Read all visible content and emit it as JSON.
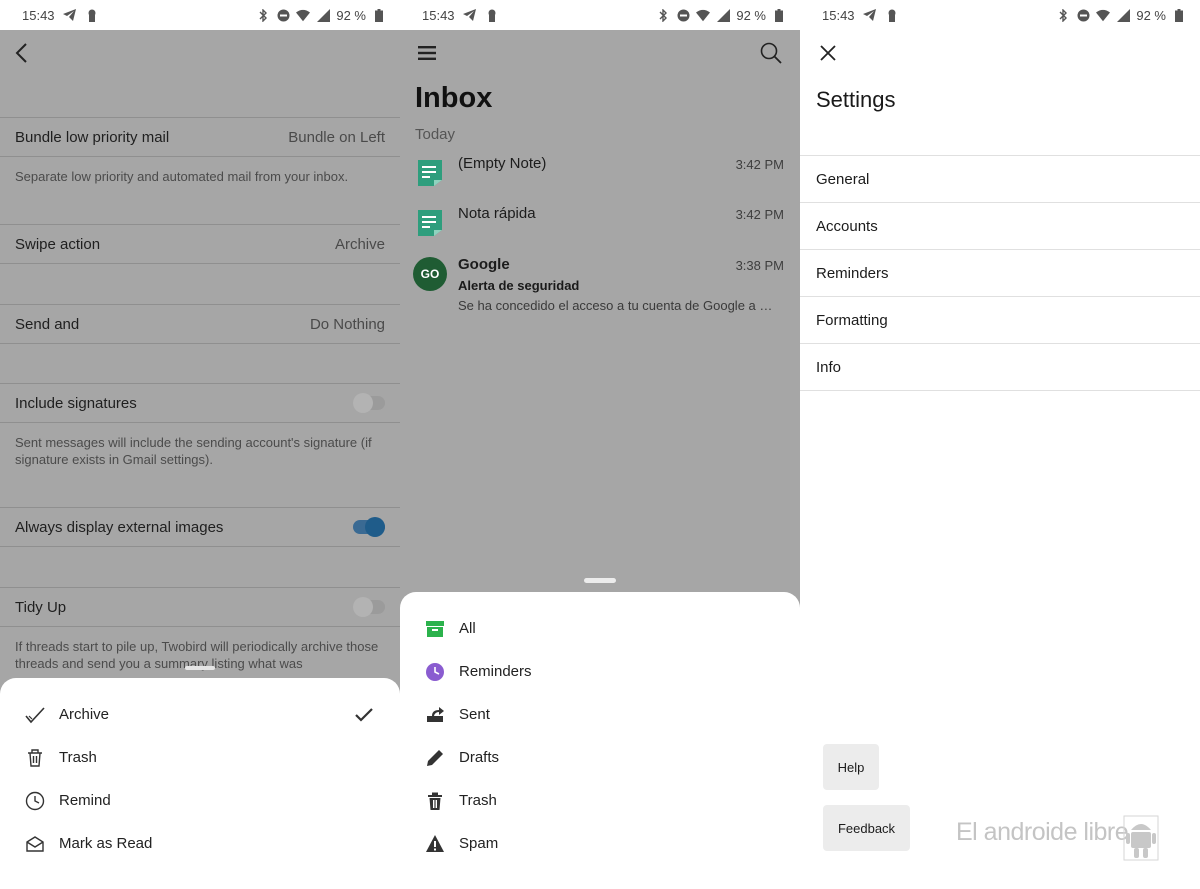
{
  "status": {
    "time": "15:43",
    "battery": "92 %"
  },
  "panel1": {
    "back_icon": "chevron-left-icon",
    "rows": [
      {
        "label": "Bundle low priority mail",
        "value": "Bundle on Left"
      },
      {
        "label": "Swipe action",
        "value": "Archive"
      },
      {
        "label": "Send and",
        "value": "Do Nothing"
      },
      {
        "label": "Include signatures",
        "toggle": "off"
      },
      {
        "label": "Always display external images",
        "toggle": "on"
      },
      {
        "label": "Tidy Up",
        "toggle": "off"
      }
    ],
    "descriptions": {
      "bundle": "Separate low priority and automated mail from your inbox.",
      "signatures": "Sent messages will include the sending account's signature (if signature exists in Gmail settings).",
      "tidy": "If threads start to pile up, Twobird will periodically archive those threads and send you a summary listing what was"
    },
    "sheet": [
      {
        "label": "Archive",
        "icon": "check-outline-icon",
        "selected": true
      },
      {
        "label": "Trash",
        "icon": "trash-icon"
      },
      {
        "label": "Remind",
        "icon": "clock-icon"
      },
      {
        "label": "Mark as Read",
        "icon": "envelope-open-icon"
      }
    ]
  },
  "panel2": {
    "title": "Inbox",
    "section": "Today",
    "mails": [
      {
        "from": "(Empty Note)",
        "time": "3:42 PM",
        "type": "note"
      },
      {
        "from": "Nota rápida",
        "time": "3:42 PM",
        "type": "note"
      },
      {
        "from": "Google",
        "time": "3:38 PM",
        "type": "contact",
        "initials": "GO",
        "subject": "Alerta de seguridad",
        "preview": "Se ha concedido el acceso a tu cuenta de Google a …"
      }
    ],
    "folders": [
      {
        "label": "All",
        "icon": "archive-box-icon",
        "color": "#2bb24c"
      },
      {
        "label": "Reminders",
        "icon": "clock-icon",
        "color": "#8a5cd0"
      },
      {
        "label": "Sent",
        "icon": "send-icon",
        "color": "#333333"
      },
      {
        "label": "Drafts",
        "icon": "pencil-icon",
        "color": "#333333"
      },
      {
        "label": "Trash",
        "icon": "trash-icon",
        "color": "#333333"
      },
      {
        "label": "Spam",
        "icon": "warning-icon",
        "color": "#333333"
      }
    ]
  },
  "panel3": {
    "title": "Settings",
    "items": [
      "General",
      "Accounts",
      "Reminders",
      "Formatting",
      "Info"
    ],
    "help_label": "Help",
    "feedback_label": "Feedback",
    "watermark": "El androide libre"
  },
  "colors": {
    "dim_overlay": "#a6a6a6",
    "note_green": "#2e9e7d",
    "avatar_green": "#1f5c33",
    "toggle_on": "#1f5c8a"
  }
}
